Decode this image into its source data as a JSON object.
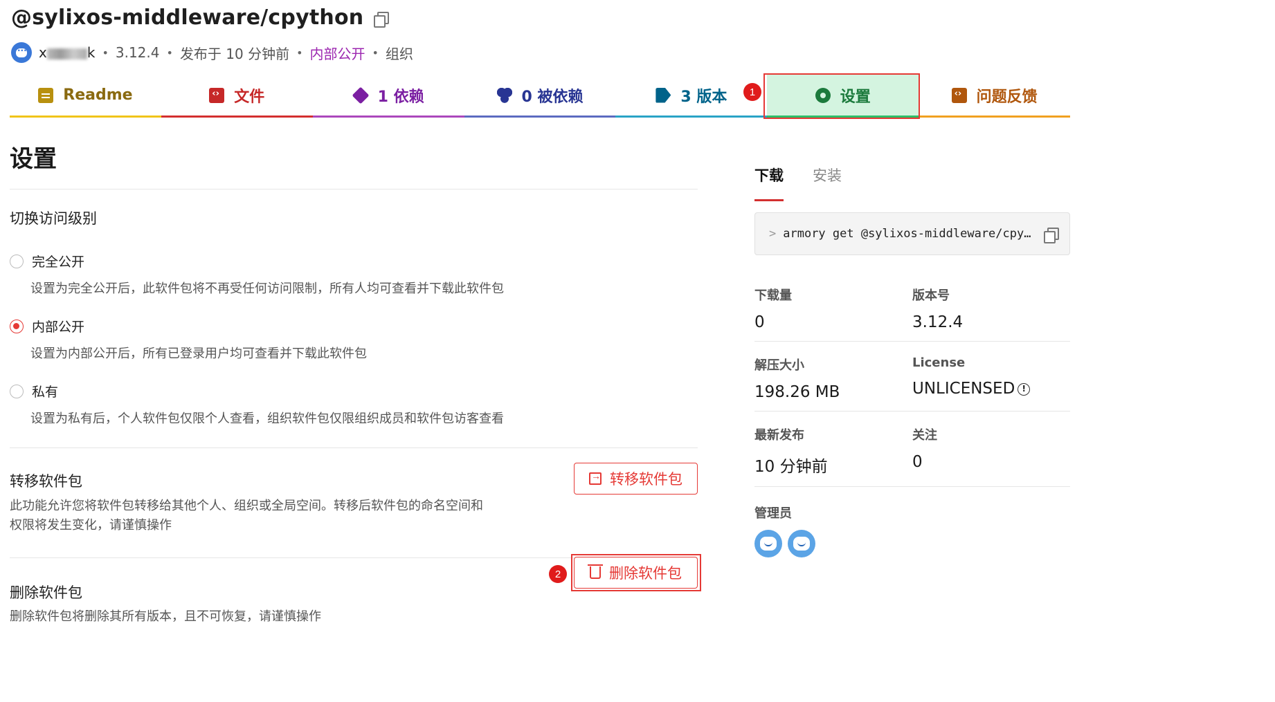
{
  "package": {
    "name": "@sylixos-middleware/cpython",
    "user": "x    k",
    "version": "3.12.4",
    "published": "发布于 10 分钟前",
    "visibility": "内部公开",
    "owner_type": "组织"
  },
  "tabs": [
    {
      "label": "Readme",
      "icon": "doc-icon"
    },
    {
      "label": "文件",
      "icon": "code-file-icon"
    },
    {
      "label": "1 依赖",
      "icon": "cube-icon"
    },
    {
      "label": "0 被依赖",
      "icon": "cubes-icon"
    },
    {
      "label": "3 版本",
      "icon": "tags-icon"
    },
    {
      "label": "设置",
      "icon": "gear-icon"
    },
    {
      "label": "问题反馈",
      "icon": "feedback-icon"
    }
  ],
  "annotations": [
    "1",
    "2"
  ],
  "settings": {
    "title": "设置",
    "access_title": "切换访问级别",
    "options": [
      {
        "label": "完全公开",
        "desc": "设置为完全公开后，此软件包将不再受任何访问限制，所有人均可查看并下载此软件包",
        "checked": false
      },
      {
        "label": "内部公开",
        "desc": "设置为内部公开后，所有已登录用户均可查看并下载此软件包",
        "checked": true
      },
      {
        "label": "私有",
        "desc": "设置为私有后，个人软件包仅限个人查看，组织软件包仅限组织成员和软件包访客查看",
        "checked": false
      }
    ],
    "transfer": {
      "title": "转移软件包",
      "desc_line1": "此功能允许您将软件包转移给其他个人、组织或全局空间。转移后软件包的命名空间和",
      "desc_line2": "权限将发生变化，请谨慎操作",
      "button": "转移软件包"
    },
    "delete": {
      "title": "删除软件包",
      "desc": "删除软件包将删除其所有版本，且不可恢复，请谨慎操作",
      "button": "删除软件包"
    }
  },
  "sidebar": {
    "tabs": [
      "下载",
      "安装"
    ],
    "command_prompt": ">",
    "command": "armory get @sylixos-middleware/cpython",
    "stats": [
      {
        "label": "下载量",
        "value": "0"
      },
      {
        "label": "版本号",
        "value": "3.12.4"
      },
      {
        "label": "解压大小",
        "value": "198.26 MB"
      },
      {
        "label": "License",
        "value": "UNLICENSED"
      },
      {
        "label": "最新发布",
        "value": "10 分钟前"
      },
      {
        "label": "关注",
        "value": "0"
      }
    ],
    "admins_label": "管理员"
  }
}
